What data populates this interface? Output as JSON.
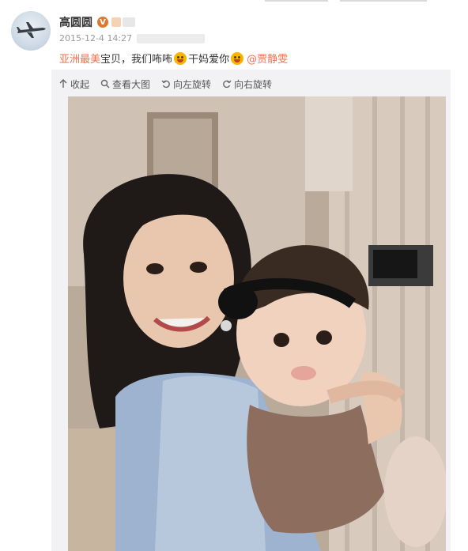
{
  "post": {
    "author": "高圆圆",
    "verified_badge": "V",
    "date": "2015-12-4",
    "time": "14:27",
    "text": {
      "part1_red": "亚洲",
      "part2": "最美",
      "part3_red": "宝贝",
      "part4": "，我们咘咘",
      "part5": "干妈爱你",
      "mention": "@贾静雯"
    }
  },
  "toolbar": {
    "collapse": "收起",
    "view_large": "查看大图",
    "rotate_left": "向左旋转",
    "rotate_right": "向右旋转"
  },
  "icons": {
    "avatar": "avatar-airplane",
    "verified": "verified-badge-icon",
    "collapse": "up-arrow-icon",
    "view_large": "magnifier-icon",
    "rotate_left": "rotate-left-icon",
    "rotate_right": "rotate-right-icon"
  },
  "colors": {
    "accent": "#eb7350",
    "name": "#333333",
    "meta": "#999999",
    "card_bg": "#f2f2f5"
  }
}
